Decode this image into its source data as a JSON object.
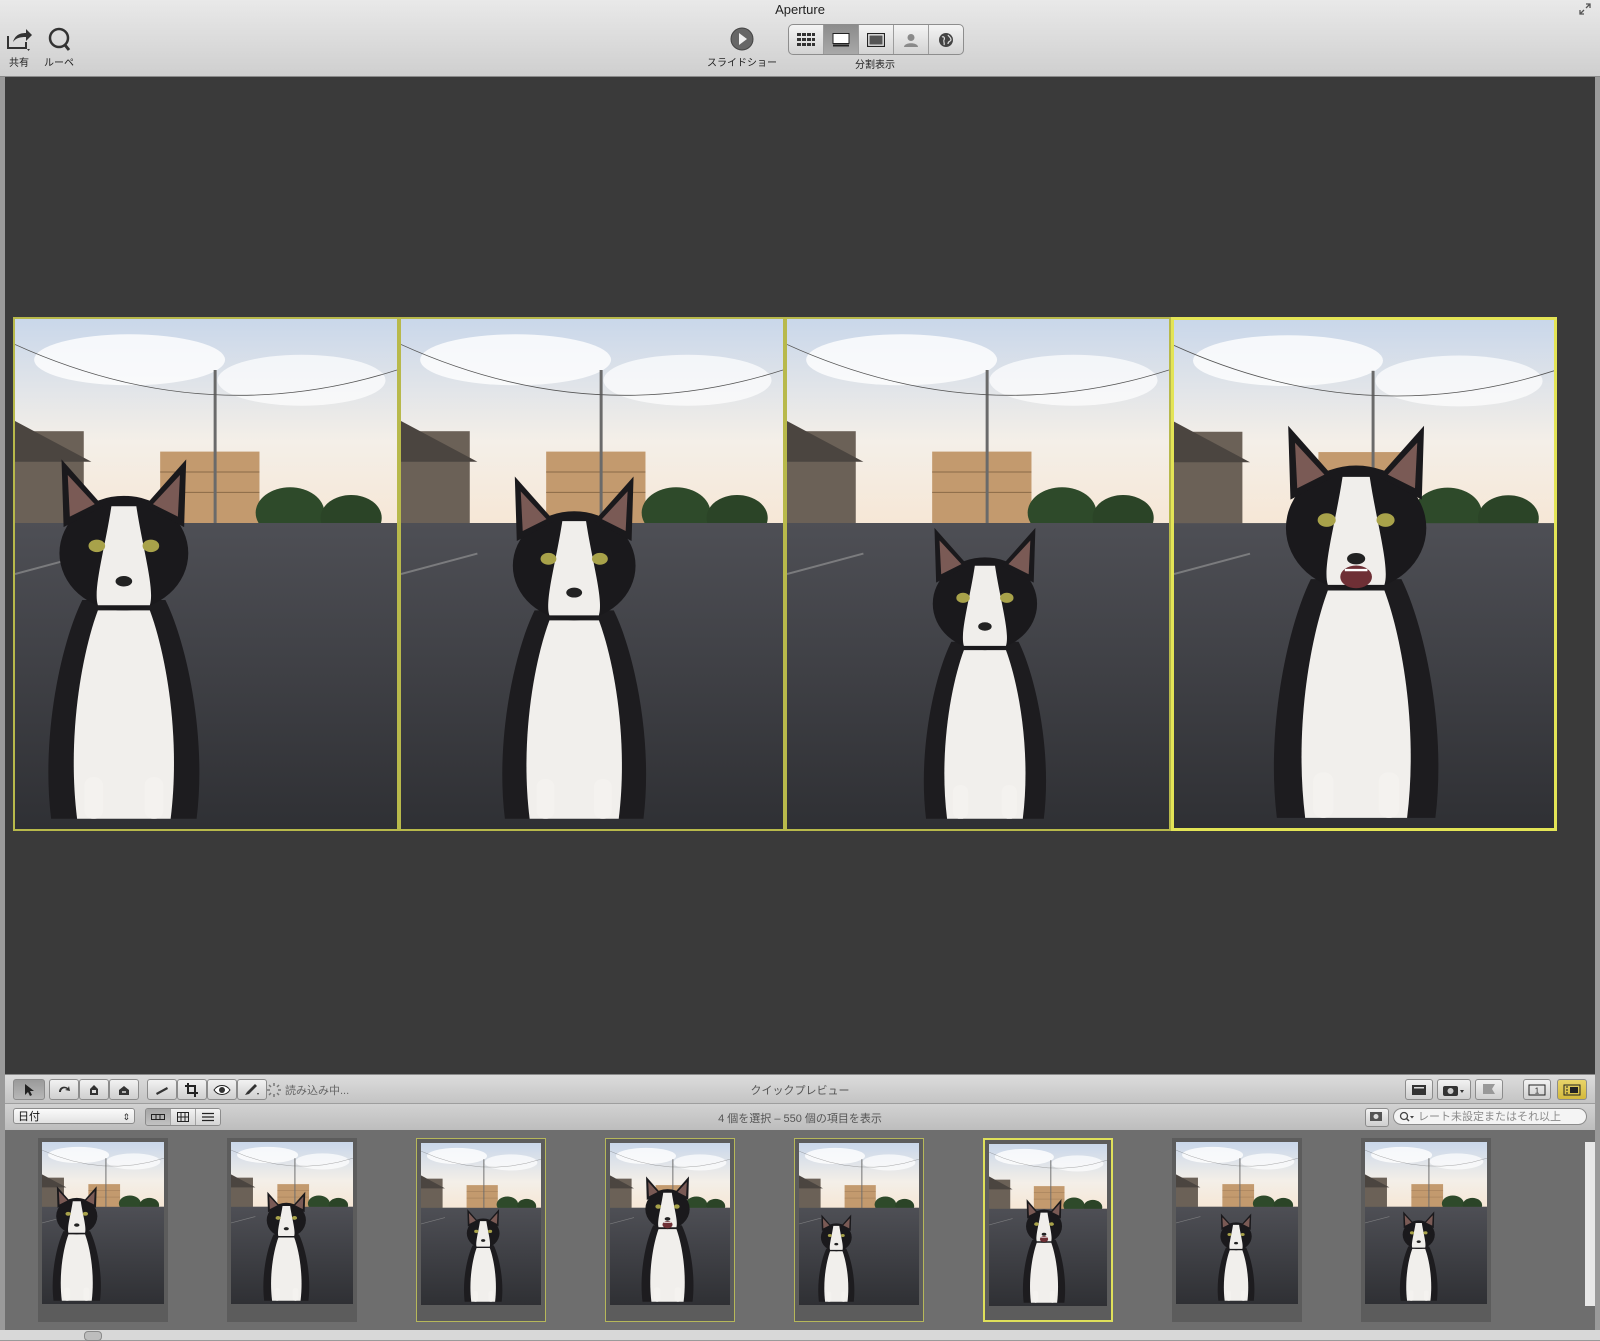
{
  "window": {
    "title": "Aperture"
  },
  "toolbar": {
    "share_label": "共有",
    "loupe_label": "ルーペ",
    "slideshow_label": "スライドショー",
    "split_view_label": "分割表示",
    "view_modes": [
      "browser-icon",
      "split-view-icon",
      "viewer-icon",
      "faces-icon",
      "places-icon"
    ],
    "active_view_mode": "split-view-icon"
  },
  "viewer": {
    "photos": [
      {
        "name": "photo-cat-1",
        "selected": true,
        "primary": false
      },
      {
        "name": "photo-cat-2",
        "selected": true,
        "primary": false
      },
      {
        "name": "photo-cat-3",
        "selected": true,
        "primary": false
      },
      {
        "name": "photo-cat-4",
        "selected": true,
        "primary": true
      }
    ]
  },
  "controlbar": {
    "loading_text": "読み込み中...",
    "quick_preview_label": "クイックプレビュー",
    "tools": [
      "select-arrow-icon",
      "rotate-icon",
      "stamp-icon",
      "lift-icon",
      "straighten-icon",
      "crop-icon",
      "red-eye-icon",
      "brush-icon"
    ]
  },
  "browserbar": {
    "sort_value": "日付",
    "status_text": "4 個を選択 – 550 個の項目を表示",
    "search_placeholder": "レート未設定またはそれ以上"
  },
  "filmstrip": {
    "thumbs": [
      {
        "variant": 0,
        "selected": false,
        "primary": false
      },
      {
        "variant": 1,
        "selected": false,
        "primary": false
      },
      {
        "variant": 2,
        "selected": true,
        "primary": false
      },
      {
        "variant": 3,
        "selected": true,
        "primary": false
      },
      {
        "variant": 4,
        "selected": true,
        "primary": false
      },
      {
        "variant": 5,
        "selected": true,
        "primary": true
      },
      {
        "variant": 6,
        "selected": false,
        "primary": false
      },
      {
        "variant": 7,
        "selected": false,
        "primary": false
      }
    ]
  },
  "colors": {
    "viewer_bg": "#3a3a3a",
    "selection_border": "#b8b94b",
    "primary_selection_border": "#e3e456",
    "filmstrip_bg": "#6e6e6e"
  }
}
